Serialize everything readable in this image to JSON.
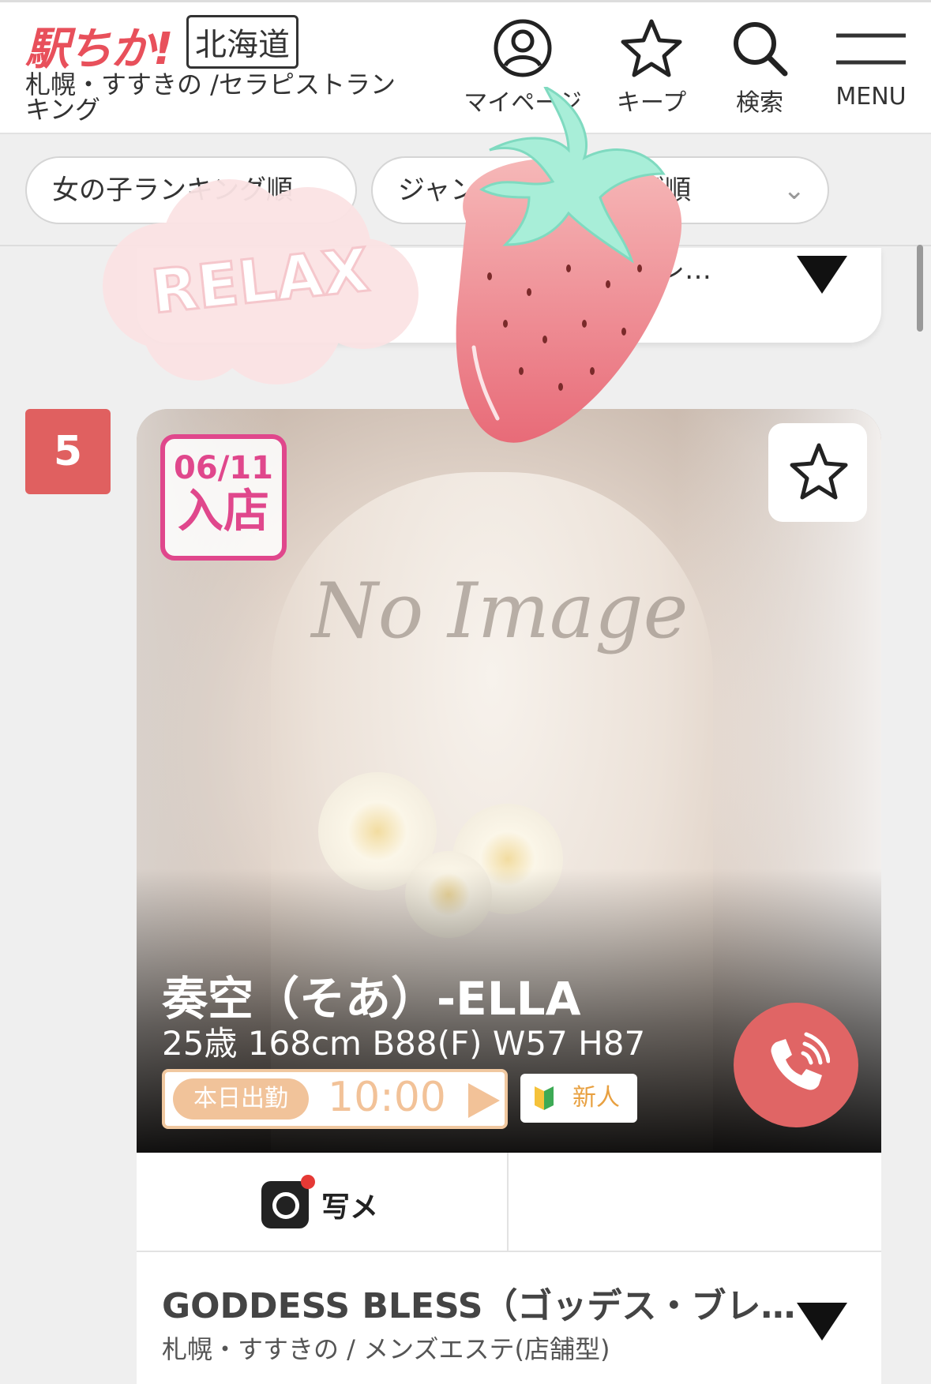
{
  "header": {
    "logo": "駅ちか!",
    "region": "北海道",
    "breadcrumb": "札幌・すすきの /セラピストランキング",
    "mypage_label": "マイページ",
    "keep_label": "キープ",
    "search_label": "検索",
    "menu_label": "MENU",
    "icons": [
      "user-icon",
      "star-icon",
      "search-icon",
      "hamburger-icon"
    ]
  },
  "filters": {
    "sort_pill": "女の子ランキング順",
    "genre_pill": "ジャンル別ランキング順"
  },
  "previous_card": {
    "truncated_text": "レ…"
  },
  "card": {
    "rank": "5",
    "new_badge_date": "06/11",
    "new_badge_label": "入店",
    "photo_watermark": "No Image",
    "name": "奏空（そあ）-ELLA",
    "profile": "25歳 168cm B88(F) W57 H87",
    "schedule_tag": "本日出勤",
    "schedule_time": "10:00",
    "newface_label": "新人",
    "photo_button_label": "写メ",
    "shop_name": "GODDESS BLESS（ゴッデス・ブレ…",
    "shop_sub": "札幌・すすきの / メンズエステ(店舗型)"
  },
  "stickers": {
    "relax_text": "RELAX"
  },
  "colors": {
    "brand": "#e8505b",
    "rank_bg": "#e06060",
    "new_badge": "#e0478c",
    "call_button": "#e06565",
    "schedule_accent": "#f1c39a"
  }
}
